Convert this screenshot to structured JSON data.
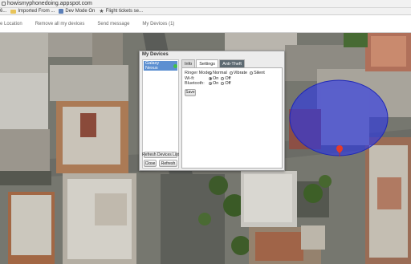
{
  "browser": {
    "url": "howismyphonedoing.appspot.com",
    "bookmarks": [
      {
        "label": "6...",
        "icon": "folder-icon"
      },
      {
        "label": "Imported From ...",
        "icon": "folder-icon"
      },
      {
        "label": "Dev Mode On",
        "icon": "page-icon"
      },
      {
        "label": "Flight tickets se...",
        "icon": "star-icon"
      }
    ]
  },
  "nav": {
    "items": [
      "e Location",
      "Remove all my devices",
      "Send message",
      "My Devices (1)"
    ]
  },
  "dialog": {
    "title": "My Devices",
    "device_name": "Galaxy Nexus",
    "refresh_list_label": "Refresh Devices List",
    "close_label": "Close",
    "refresh_label": "Refresh",
    "tabs": [
      "Info",
      "Settings",
      "Anti-Theft"
    ],
    "active_tab": "Settings",
    "settings": {
      "ringer_label": "Ringer Mode:",
      "ringer_options": [
        "Normal",
        "Vibrate",
        "Silent"
      ],
      "ringer_selected": "Normal",
      "wifi_label": "Wi-fi:",
      "wifi_options": [
        "On",
        "Off"
      ],
      "wifi_selected": "On",
      "bluetooth_label": "Bluetooth:",
      "bluetooth_options": [
        "On",
        "Off"
      ],
      "bluetooth_selected": "On",
      "save_label": "Save"
    }
  },
  "map": {
    "accuracy_circle_color": "#2f3fe0",
    "marker_color": "#e53a2a",
    "marker_icon": "location-pin-icon"
  },
  "colors": {
    "selected_device": "#5c8fd1",
    "active_tab_dark": "#5d6a72"
  }
}
